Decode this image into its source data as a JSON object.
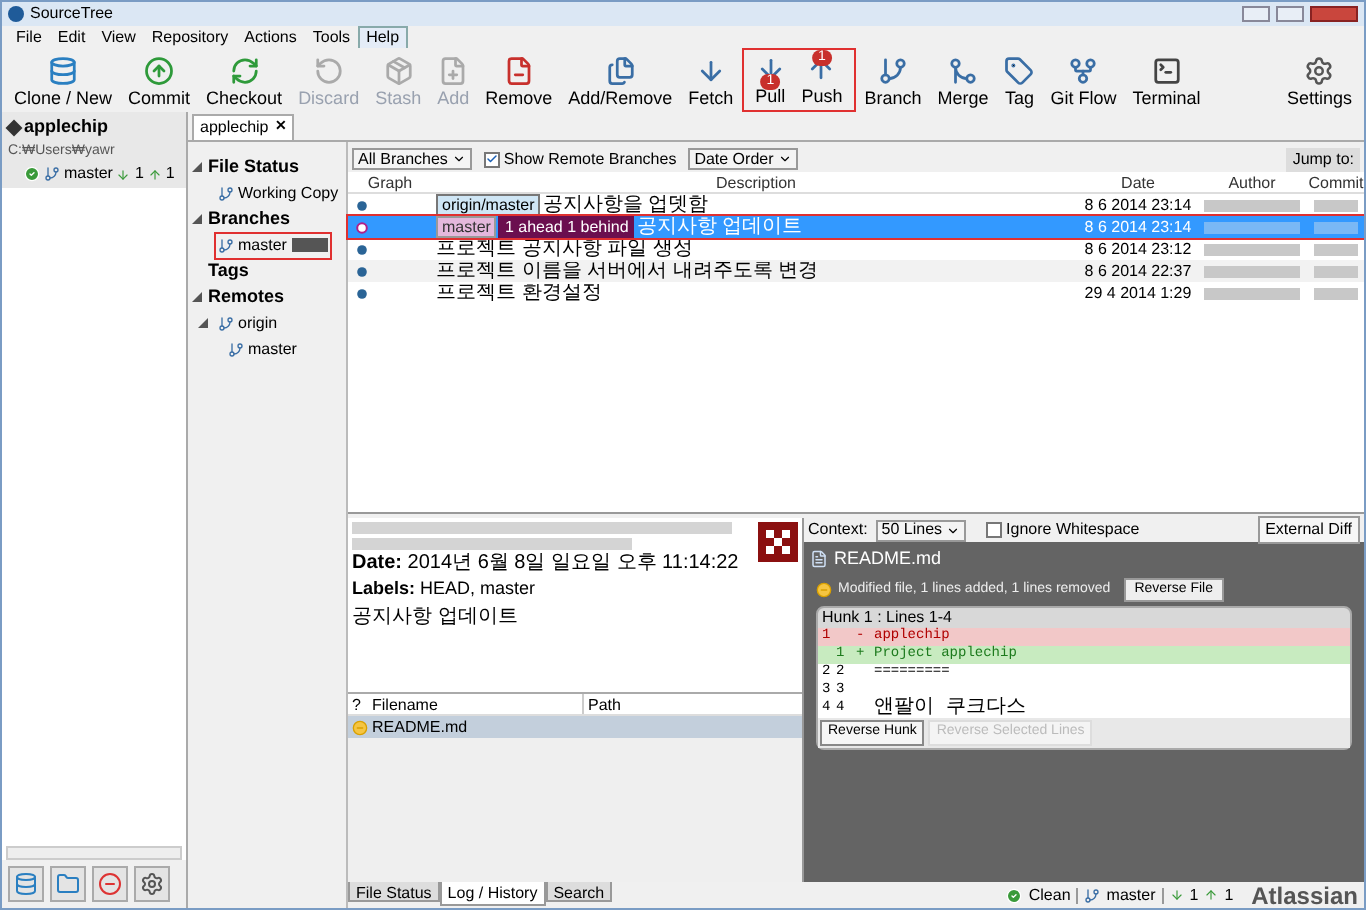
{
  "window": {
    "title": "SourceTree"
  },
  "menu": [
    {
      "label": "File",
      "selected": false
    },
    {
      "label": "Edit",
      "selected": false
    },
    {
      "label": "View",
      "selected": false
    },
    {
      "label": "Repository",
      "selected": false
    },
    {
      "label": "Actions",
      "selected": false
    },
    {
      "label": "Tools",
      "selected": false
    },
    {
      "label": "Help",
      "selected": true
    }
  ],
  "toolbar": [
    {
      "label": "Clone / New",
      "disabled": false,
      "highlighted": false
    },
    {
      "label": "Commit",
      "disabled": false,
      "highlighted": false
    },
    {
      "label": "Checkout",
      "disabled": false,
      "highlighted": false
    },
    {
      "label": "Discard",
      "disabled": true,
      "highlighted": false
    },
    {
      "label": "Stash",
      "disabled": true,
      "highlighted": false
    },
    {
      "label": "Add",
      "disabled": true,
      "highlighted": false
    },
    {
      "label": "Remove",
      "disabled": false,
      "highlighted": false
    },
    {
      "label": "Add/Remove",
      "disabled": false,
      "highlighted": false
    },
    {
      "label": "Fetch",
      "disabled": false,
      "highlighted": false
    },
    {
      "label": "Pull",
      "disabled": false,
      "highlighted": true,
      "badge": "1"
    },
    {
      "label": "Push",
      "disabled": false,
      "highlighted": true,
      "badge": "1"
    },
    {
      "label": "Branch",
      "disabled": false,
      "highlighted": false
    },
    {
      "label": "Merge",
      "disabled": false,
      "highlighted": false
    },
    {
      "label": "Tag",
      "disabled": false,
      "highlighted": false
    },
    {
      "label": "Git Flow",
      "disabled": false,
      "highlighted": false
    },
    {
      "label": "Terminal",
      "disabled": false,
      "highlighted": false
    }
  ],
  "settings_button": {
    "label": "Settings"
  },
  "repo_panel": {
    "name": "applechip",
    "path": "C:₩Users₩yawr",
    "branch": "master",
    "behind": "1",
    "ahead": "1"
  },
  "tabs": [
    {
      "label": "applechip",
      "selected": true,
      "close": "✕"
    }
  ],
  "sidebar": [
    {
      "label": "File Status",
      "expanded": true,
      "children": [
        {
          "label": "Working Copy",
          "selected": false,
          "highlighted": false
        }
      ]
    },
    {
      "label": "Branches",
      "expanded": true,
      "children": [
        {
          "label": "master",
          "selected": false,
          "highlighted": true
        }
      ]
    },
    {
      "label": "Tags"
    },
    {
      "label": "Remotes",
      "expanded": true,
      "children": [
        {
          "label": "origin",
          "expanded": true,
          "selected": false,
          "highlighted": false,
          "children": [
            {
              "label": "master",
              "selected": false,
              "highlighted": false
            }
          ]
        }
      ]
    }
  ],
  "filters": {
    "branches": "All Branches",
    "show_remote": {
      "label": "Show Remote Branches",
      "checked": true
    },
    "order": "Date Order",
    "jump": "Jump to:"
  },
  "table": {
    "columns": [
      "Graph",
      "Description",
      "Date",
      "Author",
      "Commit"
    ],
    "rows": [
      {
        "selected": false,
        "highlighted": false,
        "labels": [
          {
            "kind": "remote",
            "text": "origin/master"
          }
        ],
        "description": "공지사항을 업뎃함",
        "date": "8 6 2014 23:14"
      },
      {
        "selected": true,
        "highlighted": true,
        "labels": [
          {
            "kind": "local",
            "text": "master"
          },
          {
            "kind": "status",
            "text": "1 ahead 1 behind"
          }
        ],
        "description": "공지사항 업데이트",
        "date": "8 6 2014 23:14"
      },
      {
        "selected": false,
        "highlighted": false,
        "labels": [],
        "description": "프로젝트 공지사항 파일 생성",
        "date": "8 6 2014 23:12"
      },
      {
        "selected": false,
        "highlighted": false,
        "labels": [],
        "description": "프로젝트 이름을 서버에서 내려주도록 변경",
        "date": "8 6 2014 22:37"
      },
      {
        "selected": false,
        "highlighted": false,
        "labels": [],
        "description": "프로젝트 환경설정",
        "date": "29 4 2014 1:29"
      }
    ]
  },
  "details": {
    "date_label": "Date:",
    "date": "2014년 6월 8일 일요일 오후 11:14:22",
    "labels_label": "Labels:",
    "labels": "HEAD, master",
    "message": "공지사항 업데이트"
  },
  "files": {
    "columns": [
      "?",
      "Filename",
      "Path"
    ],
    "rows": [
      {
        "name": "README.md",
        "selected": true
      }
    ]
  },
  "bottom_tabs": [
    {
      "label": "File Status",
      "selected": false
    },
    {
      "label": "Log / History",
      "selected": true
    },
    {
      "label": "Search",
      "selected": false
    }
  ],
  "diff": {
    "context_label": "Context:",
    "context": "50 Lines",
    "ignore_whitespace": {
      "label": "Ignore Whitespace",
      "checked": false
    },
    "external": "External Diff",
    "file": "README.md",
    "summary": "Modified file, 1 lines added, 1 lines removed",
    "reverse_file": "Reverse File",
    "hunk": "Hunk 1 : Lines 1-4",
    "lines": [
      {
        "kind": "removed",
        "old": "1",
        "sign": "-",
        "text": "applechip"
      },
      {
        "kind": "added",
        "new": "1",
        "sign": "+",
        "text": "Project applechip"
      },
      {
        "kind": "context",
        "old": "2",
        "new": "2",
        "text": "========="
      },
      {
        "kind": "context",
        "old": "3",
        "new": "3"
      },
      {
        "kind": "context",
        "old": "4",
        "new": "4",
        "text": "앤팔이 쿠크다스"
      }
    ],
    "reverse_hunk": {
      "label": "Reverse Hunk",
      "disabled": false
    },
    "reverse_lines": {
      "label": "Reverse Selected Lines",
      "disabled": true
    }
  },
  "status_bar": {
    "state": "Clean",
    "branch": "master",
    "behind": "1",
    "ahead": "1",
    "brand": "Atlassian"
  }
}
